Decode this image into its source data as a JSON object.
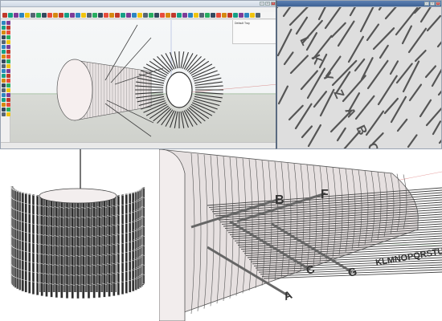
{
  "left_window": {
    "title": "",
    "menu": [],
    "status": "",
    "tray_title": "Default Tray"
  },
  "right_window": {
    "title": ""
  },
  "letters": {
    "upper": [
      "B",
      "F"
    ],
    "lower": [
      "A",
      "C",
      "G"
    ],
    "strip": "KLMNOPQRSTU",
    "top_right": [
      "L",
      "K",
      "Y",
      "Z",
      "A",
      "B",
      "C"
    ]
  },
  "colors": {
    "accent": "#3e6295",
    "model_fill": "#f6efef",
    "model_line": "#6a6262",
    "ground": "#d2d4cf"
  }
}
